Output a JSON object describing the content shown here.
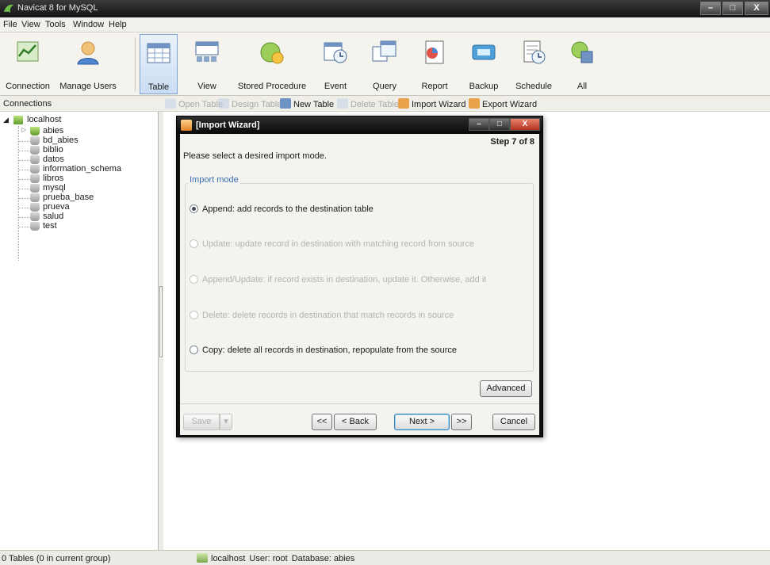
{
  "window": {
    "title": "Navicat 8 for MySQL",
    "controls": {
      "minimize": "–",
      "maximize": "□",
      "close": "X"
    }
  },
  "menubar": [
    "File",
    "View",
    "Tools",
    "Window",
    "Help"
  ],
  "toolbar": {
    "buttons": [
      {
        "label": "Connection",
        "icon": "connection-icon"
      },
      {
        "label": "Manage Users",
        "icon": "user-icon"
      },
      {
        "label": "Table",
        "icon": "table-icon",
        "active": true
      },
      {
        "label": "View",
        "icon": "view-icon"
      },
      {
        "label": "Stored Procedure",
        "icon": "stored-procedure-icon"
      },
      {
        "label": "Event",
        "icon": "event-icon"
      },
      {
        "label": "Query",
        "icon": "query-icon"
      },
      {
        "label": "Report",
        "icon": "report-icon"
      },
      {
        "label": "Backup",
        "icon": "backup-icon"
      },
      {
        "label": "Schedule",
        "icon": "schedule-icon"
      },
      {
        "label": "All",
        "icon": "all-icon"
      }
    ]
  },
  "connections": {
    "header": "Connections",
    "root": "localhost",
    "databases": [
      {
        "name": "abies",
        "open": true
      },
      {
        "name": "bd_abies",
        "open": false
      },
      {
        "name": "biblio",
        "open": false
      },
      {
        "name": "datos",
        "open": false
      },
      {
        "name": "information_schema",
        "open": false
      },
      {
        "name": "libros",
        "open": false
      },
      {
        "name": "mysql",
        "open": false
      },
      {
        "name": "prueba_base",
        "open": false
      },
      {
        "name": "prueva",
        "open": false
      },
      {
        "name": "salud",
        "open": false
      },
      {
        "name": "test",
        "open": false
      }
    ]
  },
  "object_toolbar": {
    "open_table": "Open Table",
    "design_table": "Design Table",
    "new_table": "New Table",
    "delete_table": "Delete Table",
    "import_wizard": "Import Wizard",
    "export_wizard": "Export Wizard"
  },
  "dialog": {
    "title": "[Import Wizard]",
    "step": "Step 7 of 8",
    "prompt": "Please select a desired import mode.",
    "group_label": "Import mode",
    "options": [
      {
        "label": "Append: add records to the destination table",
        "checked": true,
        "enabled": true
      },
      {
        "label": "Update: update record in destination with matching record from source",
        "checked": false,
        "enabled": false
      },
      {
        "label": "Append/Update: if record exists in destination, update it. Otherwise, add it",
        "checked": false,
        "enabled": false
      },
      {
        "label": "Delete: delete records in destination that match records in source",
        "checked": false,
        "enabled": false
      },
      {
        "label": "Copy: delete all records in destination, repopulate from the source",
        "checked": false,
        "enabled": true
      }
    ],
    "buttons": {
      "advanced": "Advanced",
      "save": "Save",
      "save_arrow": "▾",
      "first": "<<",
      "back": "< Back",
      "next": "Next >",
      "last": ">>",
      "cancel": "Cancel"
    }
  },
  "status": {
    "left": "0 Tables (0 in current group)",
    "connection": "localhost",
    "user": "User: root",
    "database": "Database: abies"
  }
}
